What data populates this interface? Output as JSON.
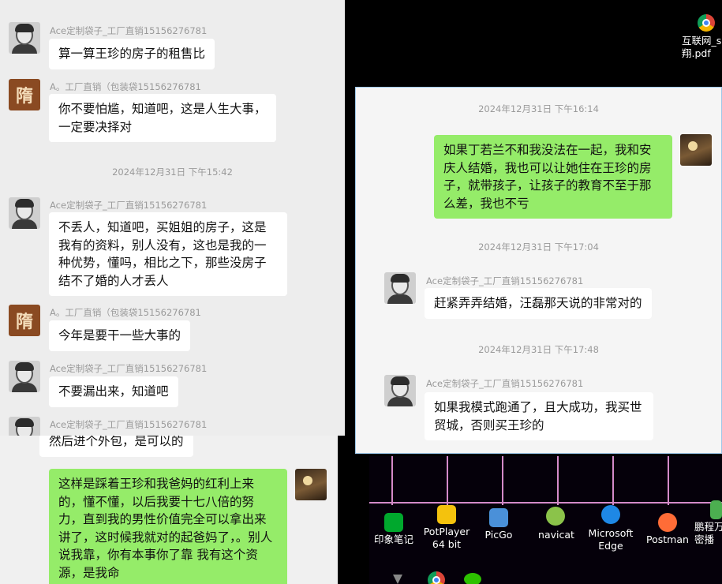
{
  "panel1": {
    "messages": [
      {
        "sender": "Ace定制袋子_工厂直销15156276781",
        "text": "算一算王珍的房子的租售比"
      },
      {
        "sender": "A。工厂直销（包装袋15156276781",
        "text": "你不要怕尴，知道吧，这是人生大事，一定要决择对"
      },
      {
        "time": "2024年12月31日 下午15:42"
      },
      {
        "sender": "Ace定制袋子_工厂直销15156276781",
        "text": "不丢人，知道吧，买姐姐的房子，这是我有的资料，别人没有，这也是我的一种优势，懂吗，相比之下，那些没房子结不了婚的人才丢人"
      },
      {
        "sender": "A。工厂直销（包装袋15156276781",
        "text": "今年是要干一些大事的"
      },
      {
        "sender": "Ace定制袋子_工厂直销15156276781",
        "text": "不要漏出来，知道吧"
      },
      {
        "sender": "Ace定制袋子_工厂直销15156276781",
        "text": ""
      }
    ],
    "avatar_sui": "隋"
  },
  "panel2": {
    "messages": [
      {
        "text": "然后进个外包，是可以的"
      },
      {
        "text": "这样是踩着王珍和我爸妈的红利上来的，懂不懂，以后我要十七八倍的努力，直到我的男性价值完全可以拿出来讲了，这时候我就对的起爸妈了，。别人说我靠，你有本事你了靠 我有这个资源，是我命"
      }
    ]
  },
  "panel3": {
    "messages": [
      {
        "time": "2024年12月31日 下午16:14"
      },
      {
        "text": "如果丁若兰不和我没法在一起，我和安庆人结婚，我也可以让她住在王珍的房子，就带孩子，让孩子的教育不至于那么差，我也不亏"
      },
      {
        "time": "2024年12月31日 下午17:04"
      },
      {
        "sender": "Ace定制袋子_工厂直销15156276781",
        "text": "赶紧弄弄结婚，汪磊那天说的非常对的"
      },
      {
        "time": "2024年12月31日 下午17:48"
      },
      {
        "sender": "Ace定制袋子_工厂直销15156276781",
        "text": "如果我模式跑通了，且大成功，我买世贸城，否则买王珍的"
      }
    ]
  },
  "desktop": {
    "top_file": "互联网_s\n翔.pdf",
    "icons": [
      {
        "label": "印象笔记",
        "icon": "evernote-icon",
        "color": "#00a82d"
      },
      {
        "label": "PotPlayer\n64 bit",
        "icon": "potplayer-icon",
        "color": "#f4c20d"
      },
      {
        "label": "PicGo",
        "icon": "picgo-icon",
        "color": "#4a90d9"
      },
      {
        "label": "navicat",
        "icon": "navicat-icon",
        "color": "#8bc34a"
      },
      {
        "label": "Microsoft\nEdge",
        "icon": "edge-icon",
        "color": "#1e88e5"
      },
      {
        "label": "Postman",
        "icon": "postman-icon",
        "color": "#ff6c37"
      },
      {
        "label": "鹏程万\n密播",
        "icon": "app-icon",
        "color": "#4caf50"
      }
    ]
  }
}
